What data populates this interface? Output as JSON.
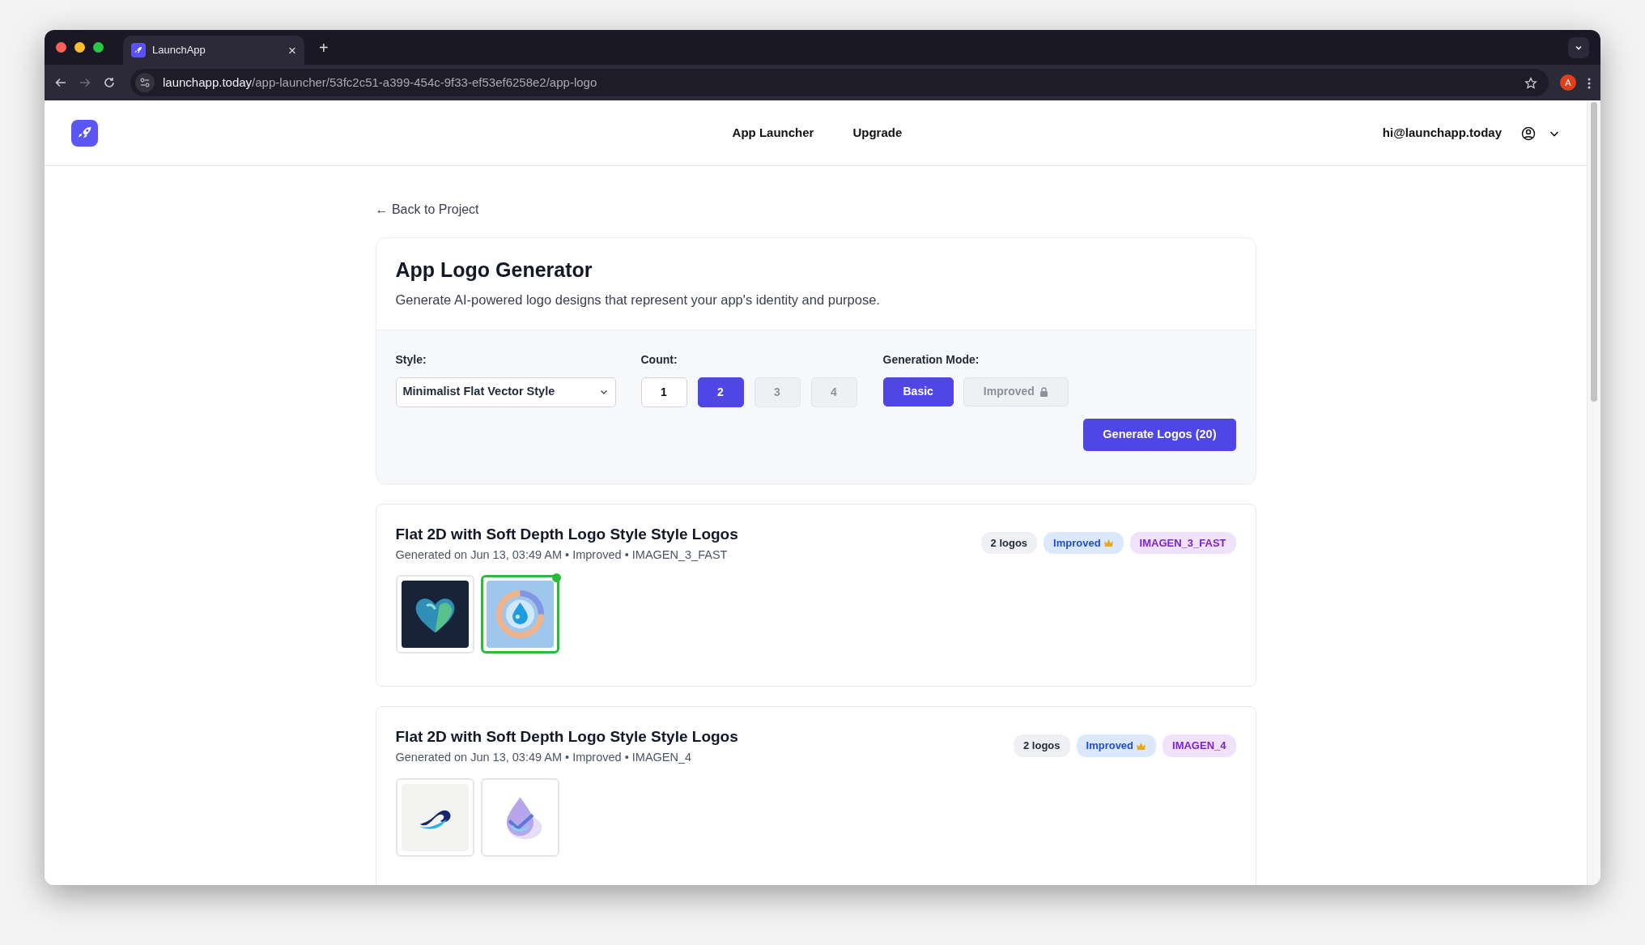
{
  "browser": {
    "tab": {
      "title": "LaunchApp",
      "close": "×"
    },
    "new_tab": "+",
    "address": {
      "host": "launchapp.today",
      "path": "/app-launcher/53fc2c51-a399-454c-9f33-ef53ef6258e2/app-logo"
    },
    "profile": "A"
  },
  "header": {
    "nav": [
      {
        "label": "App Launcher"
      },
      {
        "label": "Upgrade"
      }
    ],
    "user_email": "hi@launchapp.today"
  },
  "back_link": "← Back to Project",
  "generator": {
    "title": "App Logo Generator",
    "description": "Generate AI-powered logo designs that represent your app's identity and purpose.",
    "style": {
      "label": "Style:",
      "value": "Minimalist Flat Vector Style"
    },
    "count": {
      "label": "Count:",
      "options": [
        {
          "label": "1",
          "selected": false,
          "disabled": false
        },
        {
          "label": "2",
          "selected": true,
          "disabled": false
        },
        {
          "label": "3",
          "selected": false,
          "disabled": true
        },
        {
          "label": "4",
          "selected": false,
          "disabled": true
        }
      ]
    },
    "mode": {
      "label": "Generation Mode:",
      "options": [
        {
          "label": "Basic",
          "selected": true,
          "locked": false
        },
        {
          "label": "Improved",
          "selected": false,
          "locked": true
        }
      ]
    },
    "generate_button": "Generate Logos (20)"
  },
  "batches": [
    {
      "title": "Flat 2D with Soft Depth Logo Style Style Logos",
      "subtitle": "Generated on Jun 13, 03:49 AM • Improved • IMAGEN_3_FAST",
      "count_badge": "2 logos",
      "mode_badge": {
        "label": "Improved",
        "premium": true
      },
      "model_badge": "IMAGEN_3_FAST",
      "logos": [
        {
          "kind": "picture",
          "selected": false
        },
        {
          "kind": "picture",
          "selected": true
        }
      ]
    },
    {
      "title": "Flat 2D with Soft Depth Logo Style Style Logos",
      "subtitle": "Generated on Jun 13, 03:49 AM • Improved • IMAGEN_4",
      "count_badge": "2 logos",
      "mode_badge": {
        "label": "Improved",
        "premium": true
      },
      "model_badge": "IMAGEN_4",
      "logos": [
        {
          "kind": "picture",
          "selected": false
        },
        {
          "kind": "picture",
          "selected": false
        }
      ]
    }
  ]
}
